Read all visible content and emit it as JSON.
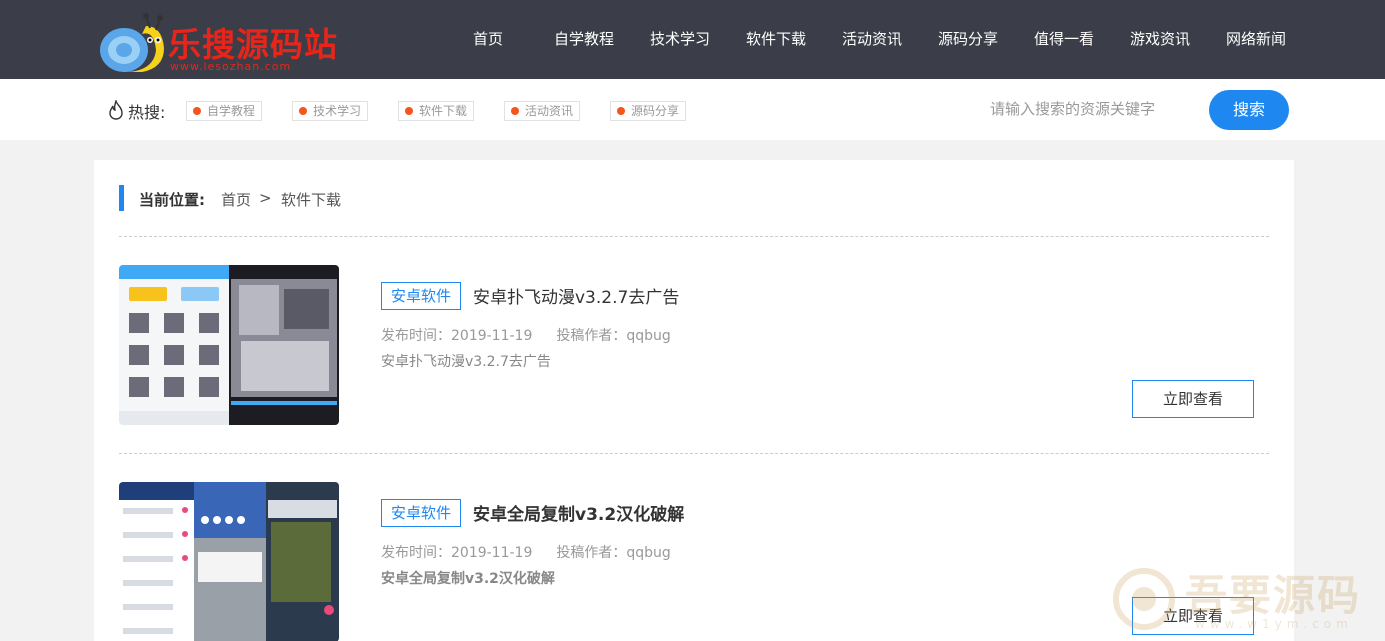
{
  "header": {
    "logo_text": "乐搜源码站",
    "logo_url": "www.lesozhan.com",
    "nav": [
      "首页",
      "自学教程",
      "技术学习",
      "软件下载",
      "活动资讯",
      "源码分享",
      "值得一看",
      "游戏资讯",
      "网络新闻"
    ]
  },
  "hotsearch": {
    "label": "热搜:",
    "tags": [
      "自学教程",
      "技术学习",
      "软件下载",
      "活动资讯",
      "源码分享"
    ],
    "search_placeholder": "请输入搜索的资源关键字",
    "search_button": "搜索"
  },
  "breadcrumb": {
    "label": "当前位置:",
    "home": "首页",
    "separator": ">",
    "current": "软件下载"
  },
  "items": [
    {
      "category": "安卓软件",
      "title": "安卓扑飞动漫v3.2.7去广告",
      "meta_date": "发布时间：2019-11-19",
      "meta_author": "投稿作者：qqbug",
      "desc": "安卓扑飞动漫v3.2.7去广告",
      "button": "立即查看"
    },
    {
      "category": "安卓软件",
      "title": "安卓全局复制v3.2汉化破解",
      "meta_date": "发布时间：2019-11-19",
      "meta_author": "投稿作者：qqbug",
      "desc": "安卓全局复制v3.2汉化破解",
      "button": "立即查看"
    }
  ],
  "watermark": {
    "text": "吾要源码",
    "url": "www.w1ym.com"
  },
  "colors": {
    "header_bg": "#3b3e48",
    "accent": "#1e87f0",
    "logo_red": "#e8251b",
    "tag_dot": "#f5541c"
  }
}
